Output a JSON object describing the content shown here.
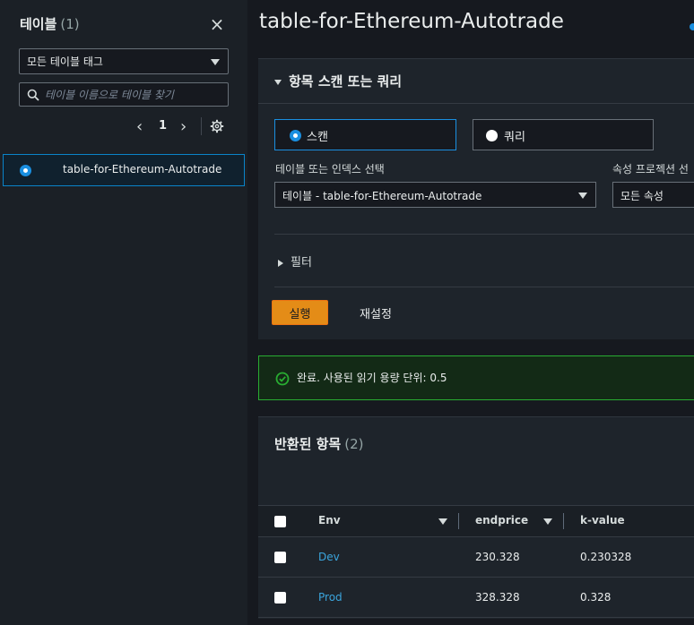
{
  "sidebar": {
    "title": "테이블",
    "count": "(1)",
    "tag_select": "모든 테이블 태그",
    "search_placeholder": "테이블 이름으로 테이블 찾기",
    "page": "1",
    "selected_table": "table-for-Ethereum-Autotrade"
  },
  "main": {
    "title": "table-for-Ethereum-Autotrade",
    "scan_panel": {
      "heading": "항목 스캔 또는 쿼리",
      "option_scan": "스캔",
      "option_query": "쿼리",
      "table_index_label": "테이블 또는 인덱스 선택",
      "table_index_value": "테이블 - table-for-Ethereum-Autotrade",
      "projection_label": "속성 프로젝션 선",
      "projection_value": "모든 속성",
      "filter_label": "필터",
      "run_label": "실행",
      "reset_label": "재설정"
    },
    "alert": {
      "text": "완료. 사용된 읽기 용량 단위: 0.5",
      "color": "#29ad32"
    },
    "results": {
      "heading": "반환된 항목",
      "count": "(2)",
      "columns": [
        "Env",
        "endprice",
        "k-value"
      ],
      "rows": [
        {
          "env": "Dev",
          "endprice": "230.328",
          "kvalue": "0.230328"
        },
        {
          "env": "Prod",
          "endprice": "328.328",
          "kvalue": "0.328"
        }
      ]
    }
  },
  "colors": {
    "accent": "#1a8fe0",
    "run_button": "#e48c17",
    "link": "#3ba5dd"
  }
}
